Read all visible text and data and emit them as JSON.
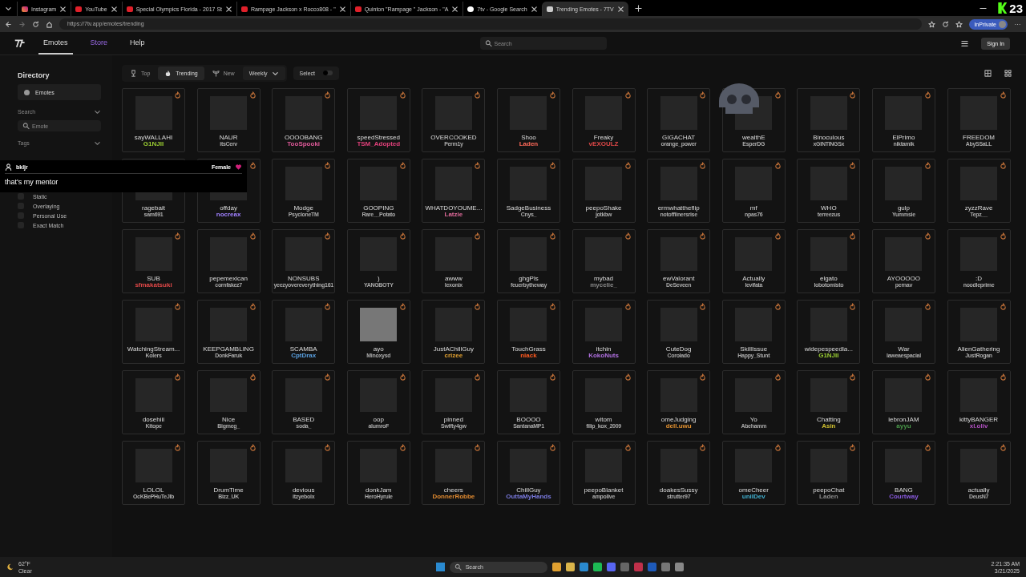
{
  "browser": {
    "tabs": [
      {
        "title": "Instagram",
        "kind": "instagram",
        "selected": false
      },
      {
        "title": "YouTube",
        "kind": "youtube",
        "selected": false
      },
      {
        "title": "Special Olympics Florida - 2017 St",
        "kind": "youtube",
        "selected": false
      },
      {
        "title": "Rampage Jackson x Rocco808 - \"",
        "kind": "youtube",
        "selected": false
      },
      {
        "title": "Quinton \"Rampage \" Jackson - \"A",
        "kind": "youtube",
        "selected": false
      },
      {
        "title": "7tv - Google Search",
        "kind": "google",
        "selected": false
      },
      {
        "title": "Trending Emotes - 7TV",
        "kind": "seventv",
        "selected": true
      }
    ],
    "url": "https://7tv.app/emotes/trending",
    "profile": "InPrivate",
    "counter": "23"
  },
  "site": {
    "nav": [
      {
        "label": "Emotes",
        "selected": true,
        "highlighted": false
      },
      {
        "label": "Store",
        "selected": false,
        "highlighted": true
      },
      {
        "label": "Help",
        "selected": false,
        "highlighted": false
      }
    ],
    "search": {
      "placeholder": "Search"
    },
    "sign_in": "Sign In"
  },
  "sidebar": {
    "title": "Directory",
    "category": "Emotes",
    "search_label": "Search",
    "search_placeholder": "Emote",
    "tags_label": "Tags",
    "filters": [
      {
        "label": "Static",
        "checked": false
      },
      {
        "label": "Overlaying",
        "checked": false
      },
      {
        "label": "Personal Use",
        "checked": false
      },
      {
        "label": "Exact Match",
        "checked": false
      }
    ]
  },
  "toolbar": {
    "sorts": [
      {
        "label": "Top",
        "kind": "trophy",
        "selected": false
      },
      {
        "label": "Trending",
        "kind": "fire",
        "selected": true
      },
      {
        "label": "New",
        "kind": "sprout",
        "selected": false
      }
    ],
    "period": "Weekly",
    "select": {
      "label": "Select",
      "on": false
    }
  },
  "emotes": [
    {
      "name": "sayWALLAHI",
      "owner": "G1NJII",
      "color": "#9acd32"
    },
    {
      "name": "NAUR",
      "owner": "itsCerv"
    },
    {
      "name": "OOOOBANG",
      "owner": "TooSpooki",
      "color": "#e05a9a"
    },
    {
      "name": "speedStressed",
      "owner": "TSM_Adopted",
      "color": "#e0407a"
    },
    {
      "name": "OVERCOOKED",
      "owner": "Perm1y"
    },
    {
      "name": "Shoo",
      "owner": "Laden",
      "color": "#ff6a5a"
    },
    {
      "name": "Freaky",
      "owner": "vEXOULZ",
      "color": "#e04848"
    },
    {
      "name": "GIGACHAT",
      "owner": "orange_power"
    },
    {
      "name": "wealthE",
      "owner": "EsperDG"
    },
    {
      "name": "Binoculous",
      "owner": "xGINTINGSx"
    },
    {
      "name": "ElPrimo",
      "owner": "niktamik"
    },
    {
      "name": "FREEDOM",
      "owner": "AbySSaLL"
    },
    {
      "name": "ragebait",
      "owner": "sam691"
    },
    {
      "name": "offday",
      "owner": "nocreax",
      "color": "#a080ff"
    },
    {
      "name": "Modge",
      "owner": "PsycloneTM"
    },
    {
      "name": "GOOPING",
      "owner": "Rare__Potato"
    },
    {
      "name": "WHATDOYOUME...",
      "owner": "Latzie",
      "color": "#e06a9a"
    },
    {
      "name": "SadgeBusiness",
      "owner": "Cnys_"
    },
    {
      "name": "peepoShake",
      "owner": "jotkbw"
    },
    {
      "name": "ermwhattheflip",
      "owner": "notoffiinersrise"
    },
    {
      "name": "mf",
      "owner": "npas76"
    },
    {
      "name": "WHO",
      "owner": "terreezus"
    },
    {
      "name": "gulp",
      "owner": "Yummsie"
    },
    {
      "name": "zyzzRave",
      "owner": "Tepz__"
    },
    {
      "name": "SUB",
      "owner": "sfmakatsuki",
      "color": "#e04848"
    },
    {
      "name": "pepemexican",
      "owner": "cornfakez7"
    },
    {
      "name": "NONSUBS",
      "owner": "yeezyovereverything161"
    },
    {
      "name": ")",
      "owner": "YANGBOTY"
    },
    {
      "name": "awww",
      "owner": "lexonix"
    },
    {
      "name": "ghgPls",
      "owner": "feuerbytheway"
    },
    {
      "name": "mybad",
      "owner": "mycelie_",
      "color": "#8a8a8a"
    },
    {
      "name": "ewValorant",
      "owner": "DeSeveen"
    },
    {
      "name": "Actually",
      "owner": "levifata"
    },
    {
      "name": "elgato",
      "owner": "lobotomisto"
    },
    {
      "name": "AYOOOOO",
      "owner": "pernav"
    },
    {
      "name": ":D",
      "owner": "noodleprime"
    },
    {
      "name": "WatchingStream...",
      "owner": "Kolers"
    },
    {
      "name": "KEEPGAMBLING",
      "owner": "DonkFaruk"
    },
    {
      "name": "SCAMBA",
      "owner": "CptDrax",
      "color": "#5aa0e0"
    },
    {
      "name": "ayo",
      "owner": "Minoxysd",
      "kind": "photo"
    },
    {
      "name": "JustAChillGuy",
      "owner": "crizee",
      "color": "#e0a030"
    },
    {
      "name": "TouchGrass",
      "owner": "niack",
      "color": "#ff5a20"
    },
    {
      "name": "itchin",
      "owner": "KokoNuts",
      "color": "#b070e0"
    },
    {
      "name": "CuteDog",
      "owner": "Corolado"
    },
    {
      "name": "SkillIssue",
      "owner": "Happy_Stunt"
    },
    {
      "name": "widepespeedla...",
      "owner": "G1NJII",
      "color": "#9acd32"
    },
    {
      "name": "War",
      "owner": "laweaespacial"
    },
    {
      "name": "AlienGathering",
      "owner": "JustRogan"
    },
    {
      "name": "dosehiii",
      "owner": "Kitope"
    },
    {
      "name": "Nice",
      "owner": "Bigmeg_"
    },
    {
      "name": "BASED",
      "owner": "soda_"
    },
    {
      "name": "oop",
      "owner": "alumroF"
    },
    {
      "name": "pinned",
      "owner": "Swifty4gw"
    },
    {
      "name": "BOOOO",
      "owner": "SantanaMP1"
    },
    {
      "name": "witom",
      "owner": "filip_kox_2009"
    },
    {
      "name": "omeJudging",
      "owner": "dell.uwu",
      "color": "#e09030"
    },
    {
      "name": "Yo",
      "owner": "Abehamm"
    },
    {
      "name": "Chatting",
      "owner": "Asin",
      "color": "#d0c030"
    },
    {
      "name": "lebronJAM",
      "owner": "ayyu",
      "color": "#4a9a4a"
    },
    {
      "name": "kittyBANGER",
      "owner": "xl.oliv",
      "color": "#b050c0"
    },
    {
      "name": "LOLOL",
      "owner": "OcKBePHuTeJlb"
    },
    {
      "name": "DrumTime",
      "owner": "Bizz_UK"
    },
    {
      "name": "devious",
      "owner": "itzyeboix"
    },
    {
      "name": "donkJam",
      "owner": "HeroHyrule"
    },
    {
      "name": "cheers",
      "owner": "DonnerRobbe",
      "color": "#e08a30"
    },
    {
      "name": "ChillGuy",
      "owner": "OuttaMyHands",
      "color": "#7a7ae0"
    },
    {
      "name": "peepoBlanket",
      "owner": "ampolive"
    },
    {
      "name": "doakesSussy",
      "owner": "strutter97"
    },
    {
      "name": "omeCheer",
      "owner": "unilDev",
      "color": "#40b0d0"
    },
    {
      "name": "peepoChat",
      "owner": "Laden",
      "color": "#8a8a8a"
    },
    {
      "name": "BANG",
      "owner": "Courtway",
      "color": "#8a5ae0"
    },
    {
      "name": "actually",
      "owner": "DeusN7"
    }
  ],
  "chat_overlay": {
    "user": "bkljr",
    "gender": "Female",
    "message": "that's my mentor"
  },
  "taskbar": {
    "temperature": "62°F",
    "weather": "Clear",
    "search": "Search",
    "time": "2:21:35 AM",
    "date": "3/21/2025"
  }
}
